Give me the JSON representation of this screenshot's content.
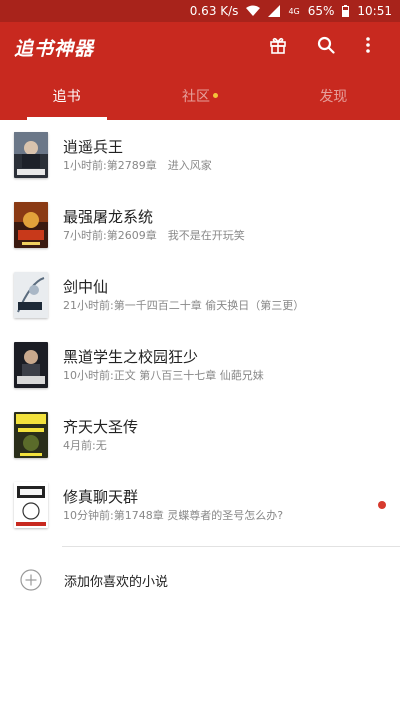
{
  "status_bar": {
    "speed": "0.63 K/s",
    "network_label": "4G",
    "battery": "65%",
    "time": "10:51"
  },
  "app": {
    "title": "追书神器",
    "icons": [
      "gift-icon",
      "search-icon",
      "more-vert-icon"
    ]
  },
  "tabs": [
    {
      "label": "追书",
      "active": true
    },
    {
      "label": "社区",
      "active": false,
      "has_dot": true
    },
    {
      "label": "发现",
      "active": false
    }
  ],
  "books": [
    {
      "title": "逍遥兵王",
      "subtitle": "1小时前:第2789章　进入风家",
      "unread": false
    },
    {
      "title": "最强屠龙系统",
      "subtitle": "7小时前:第2609章　我不是在开玩笑",
      "unread": false
    },
    {
      "title": "剑中仙",
      "subtitle": "21小时前:第一千四百二十章 偷天换日（第三更）",
      "unread": false
    },
    {
      "title": "黑道学生之校园狂少",
      "subtitle": "10小时前:正文 第八百三十七章 仙葩兄妹",
      "unread": false
    },
    {
      "title": "齐天大圣传",
      "subtitle": "4月前:无",
      "unread": false
    },
    {
      "title": "修真聊天群",
      "subtitle": "10分钟前:第1748章 灵蝶尊者的圣号怎么办?",
      "unread": true
    }
  ],
  "add_book": {
    "label": "添加你喜欢的小说"
  },
  "colors": {
    "primary": "#c8291f",
    "status_bar": "#a8231b",
    "unread_dot": "#d63a2e",
    "tab_dot": "#f4c43a"
  }
}
